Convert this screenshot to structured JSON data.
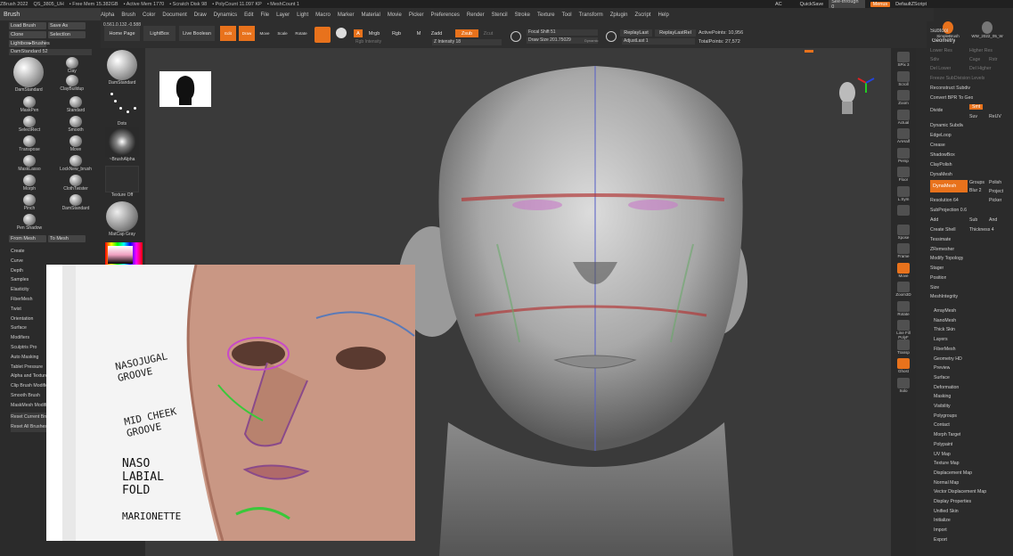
{
  "titlebar": {
    "items": [
      "ZBrush 2022",
      "QS_3805_UH",
      "• Free Mem 15.382GB",
      "• Active Mem 1770",
      "• Scratch Disk 98",
      "• PolyCount 11.097 KP",
      "• MeshCount 1"
    ],
    "right": [
      "AC",
      "QuickSave",
      "See-through 0",
      "Menus",
      "DefaultZScript"
    ]
  },
  "menubar": [
    "Alpha",
    "Brush",
    "Color",
    "Document",
    "Draw",
    "Dynamics",
    "Edit",
    "File",
    "Layer",
    "Light",
    "Macro",
    "Marker",
    "Material",
    "Movie",
    "Picker",
    "Preferences",
    "Render",
    "Stencil",
    "Stroke",
    "Texture",
    "Tool",
    "Transform",
    "Zplugin",
    "Zscript",
    "Help"
  ],
  "toolbar": {
    "home": "Home Page",
    "lightbox": "LightBox",
    "live_boolean": "Live Boolean",
    "edit": "Edit",
    "draw": "Draw",
    "move": "Move",
    "scale": "Scale",
    "rotate": "Rotate",
    "a": "A",
    "mrgb": "Mrgb",
    "rgb": "Rgb",
    "rgb_intensity": "Rgb Intensity",
    "m": "M",
    "zadd": "Zadd",
    "zsub": "Zsub",
    "zcut": "Zcut",
    "z_intensity": "Z Intensity 18",
    "focal_shift": "Focal Shift 51",
    "draw_size": "Draw Size 201.75029",
    "dynamic": "Dynamic",
    "replay_last": "ReplayLast",
    "replay_last_rel": "ReplayLastRel",
    "adjust_last": "AdjustLast 1",
    "active_points": "ActivePoints: 10,956",
    "total_points": "TotalPoints: 27,572",
    "coords": "0.561,0.132,-0.588"
  },
  "left": {
    "title": "Brush",
    "buttons": [
      "Load Brush",
      "Save As",
      "Clone",
      "SelectIon",
      "Lightbox▸Brushes"
    ],
    "dam": "DamStandard 52",
    "brushes": [
      "DamStandard",
      "Clay",
      "ClayBuildup",
      "MaskPen",
      "Standard",
      "SelectRect",
      "Smooth",
      "Transpose",
      "Move",
      "MaskLasso",
      "LockNew_brush",
      "Morph",
      "ClothTwister",
      "Pinch",
      "DamStandard",
      "Pen Shadow"
    ],
    "frommesh": "From Mesh",
    "tomesh": "To Mesh",
    "sections": [
      "Create",
      "Curve",
      "Depth",
      "Samples",
      "Elasticity",
      "FiberMesh",
      "Twist",
      "Orientation",
      "Surface",
      "Modifiers",
      "Sculptris Pro",
      "Auto Masking",
      "Tablet Pressure",
      "Alpha and Texture",
      "Clip Brush Modifiers",
      "Smooth Brush",
      "MaskMesh Modifiers"
    ],
    "reset": [
      "Reset Current Brush",
      "Reset All Brushes"
    ]
  },
  "mid": [
    "DamStandard",
    "Dots",
    "~BrushAlpha",
    "Texture Off",
    "MatCap Gray"
  ],
  "right_icons": [
    "SPix 3",
    "Scroll",
    "Zoom",
    "Actual",
    "AAHalf",
    "Persp",
    "Floor",
    "L.Sym",
    "",
    "Xpose",
    "Frame",
    "Move",
    "Zoom3D",
    "Rotate",
    "Line Fill PolyF",
    "Transp",
    "Ghost",
    "Solo"
  ],
  "right": {
    "subtool": "Subtool",
    "geometry": "Geometry",
    "geo_rows": [
      "Lower Res",
      "Higher Res",
      "Sdiv",
      "Cage",
      "Rstr",
      "Del Lower",
      "Del Higher",
      "Freeze SubDivision Levels",
      "Reconstruct Subdiv",
      "Convert BPR To Geo",
      "Divide",
      "Smt",
      "Suv",
      "ReUV"
    ],
    "dyn": [
      "Dynamic Subdiv",
      "EdgeLoop",
      "Crease",
      "ShadowBox",
      "ClayPolish",
      "DynaMesh"
    ],
    "dynamesh": {
      "btn": "DynaMesh",
      "groups": "Groups",
      "polish": "Polish",
      "blur": "Blur 2",
      "project": "Project",
      "resolution": "Resolution 64",
      "picker": "Picker",
      "subproj": "SubProjection 0.6",
      "add": "Add",
      "sub": "Sub",
      "and": "And",
      "create_shell": "Create Shell",
      "thickness": "Thickness 4"
    },
    "more": [
      "Tessimate",
      "ZRemesher",
      "Modify Topology",
      "Stager",
      "Position",
      "Size",
      "MeshIntegrity"
    ],
    "sections": [
      "ArrayMesh",
      "NanoMesh",
      "Thick Skin",
      "Layers",
      "FiberMesh",
      "Geometry HD",
      "Preview",
      "Surface",
      "Deformation",
      "Masking",
      "Visibility",
      "Polygroups",
      "Contact",
      "Morph Target",
      "Polypaint",
      "UV Map",
      "Texture Map",
      "Displacement Map",
      "Normal Map",
      "Vector Displacement Map",
      "Display Properties",
      "Unified Skin",
      "Initialize",
      "Import",
      "Export"
    ],
    "thumbs": [
      "SimpleBrush",
      "WW_2022_05_W"
    ]
  },
  "inset": {
    "labels": [
      "NASOJUGAL GROOVE",
      "MID CHEEK GROOVE",
      "NASO LABIAL FOLD",
      "MARIONETTE"
    ]
  },
  "colors": {
    "accent": "#e8721c",
    "bg": "#2b2b2b",
    "viewport": "#3a3a3a"
  }
}
